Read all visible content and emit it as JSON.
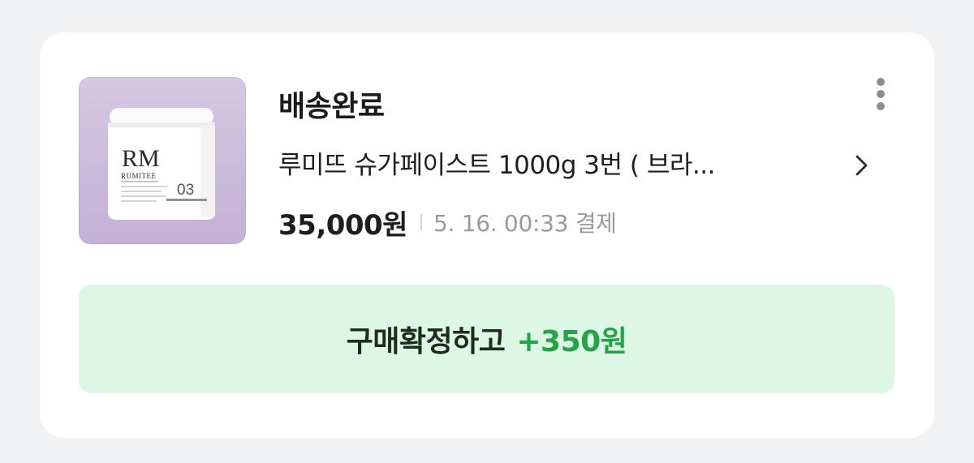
{
  "order": {
    "status": "배송완료",
    "product_title": "루미뜨 슈가페이스트 1000g 3번 ( 브라...",
    "price": "35,000원",
    "paid_at": "5. 16. 00:33 결제",
    "image": {
      "brand_mark": "RM",
      "brand_name": "RUMITEE",
      "number": "03"
    }
  },
  "actions": {
    "confirm_label": "구매확정하고",
    "confirm_reward": "+350원"
  },
  "icons": {
    "chevron": "chevron-right-icon",
    "more": "more-vertical-icon"
  },
  "colors": {
    "card_bg": "#ffffff",
    "page_bg": "#f1f2f4",
    "confirm_bg": "#dcf7e3",
    "reward_green": "#22a447",
    "thumb_bg": "#cbb9db"
  }
}
